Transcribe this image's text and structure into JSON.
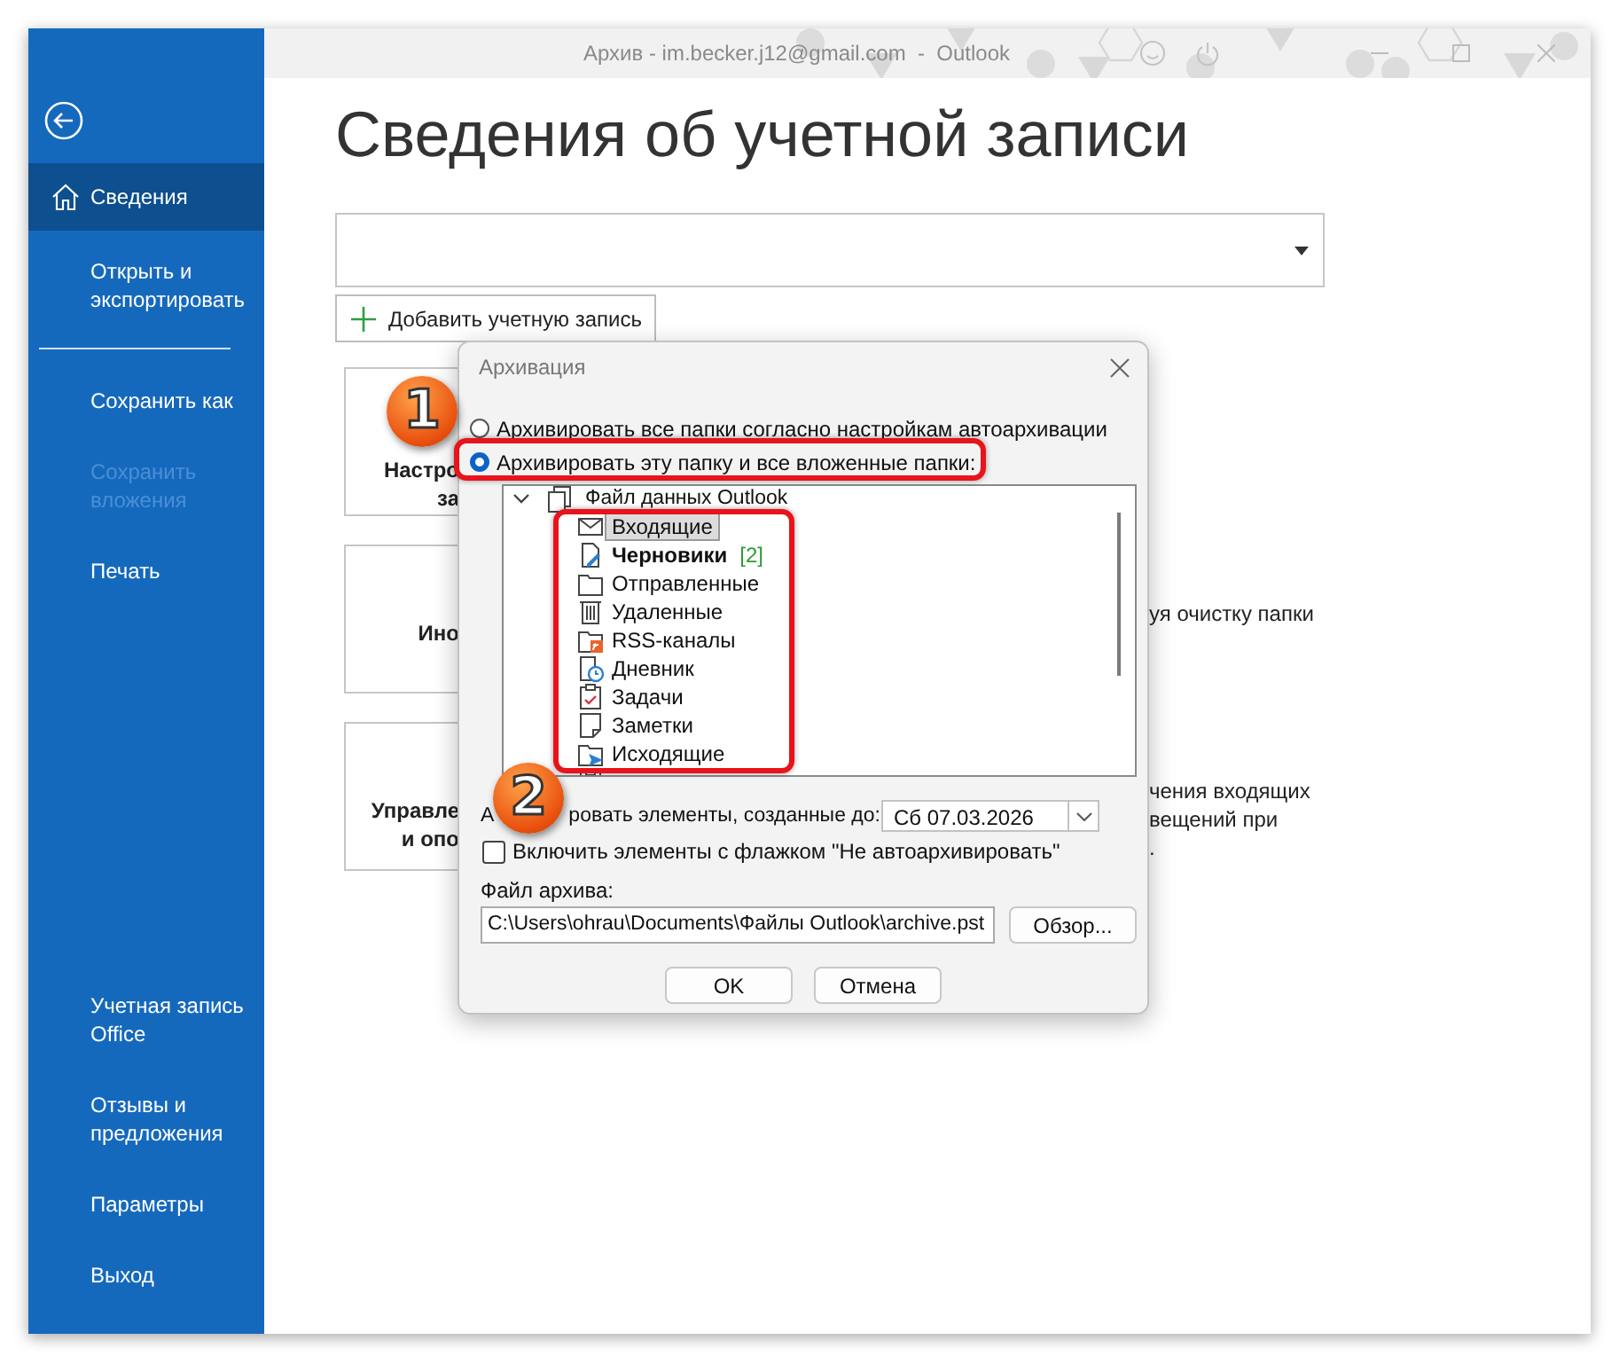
{
  "window": {
    "title": "Архив - im.becker.j12@gmail.com  -  Outlook"
  },
  "sidebar": {
    "top_items": [
      {
        "kind": "home",
        "label": "Сведения",
        "selected": true,
        "disabled": false
      },
      {
        "kind": "text",
        "label": "Открыть и\nэкспортировать",
        "selected": false,
        "disabled": false
      },
      {
        "kind": "divider"
      },
      {
        "kind": "text",
        "label": "Сохранить как",
        "selected": false,
        "disabled": false
      },
      {
        "kind": "text",
        "label": "Сохранить\nвложения",
        "selected": false,
        "disabled": true
      },
      {
        "kind": "text",
        "label": "Печать",
        "selected": false,
        "disabled": false
      }
    ],
    "bottom_items": [
      {
        "kind": "text",
        "label": "Учетная запись\nOffice",
        "selected": false,
        "disabled": false
      },
      {
        "kind": "text",
        "label": "Отзывы и\nпредложения",
        "selected": false,
        "disabled": false
      },
      {
        "kind": "text",
        "label": "Параметры",
        "selected": false,
        "disabled": false
      },
      {
        "kind": "text",
        "label": "Выход",
        "selected": false,
        "disabled": false
      }
    ]
  },
  "page": {
    "title": "Сведения об учетной записи",
    "add_account_button": "Добавить учетную запись",
    "cards": [
      {
        "lines": [
          "Настро",
          "за"
        ]
      },
      {
        "lines": [
          "Ино"
        ],
        "description": [
          "уя очистку папки"
        ]
      },
      {
        "lines": [
          "Управле",
          "и опо"
        ],
        "description": [
          "чения входящих",
          "вещений при",
          "."
        ]
      }
    ]
  },
  "dialog": {
    "title": "Архивация",
    "options": [
      {
        "label": "Архивировать все папки согласно настройкам автоархивации",
        "selected": false
      },
      {
        "label": "Архивировать эту папку и все вложенные папки:",
        "selected": true
      }
    ],
    "tree": {
      "label": "Файл данных Outlook",
      "expanded": true,
      "children": [
        {
          "kind": "inbox",
          "label": "Входящие",
          "selected": true,
          "unread": false
        },
        {
          "kind": "drafts",
          "label": "Черновики",
          "count": "[2]",
          "selected": false,
          "unread": true
        },
        {
          "kind": "folder",
          "label": "Отправленные",
          "selected": false,
          "unread": false
        },
        {
          "kind": "trash",
          "label": "Удаленные",
          "selected": false,
          "unread": false
        },
        {
          "kind": "rss",
          "label": "RSS-каналы",
          "selected": false,
          "unread": false
        },
        {
          "kind": "journal",
          "label": "Дневник",
          "selected": false,
          "unread": false
        },
        {
          "kind": "tasks",
          "label": "Задачи",
          "selected": false,
          "unread": false
        },
        {
          "kind": "notes",
          "label": "Заметки",
          "selected": false,
          "unread": false
        },
        {
          "kind": "outbox",
          "label": "Исходящие",
          "selected": false,
          "unread": false
        }
      ]
    },
    "date_label_parts": [
      "А",
      "ровать элементы, созданные до:"
    ],
    "date_value": "Сб 07.03.2026",
    "include_checkbox": {
      "label": "Включить элементы с флажком \"Не автоархивировать\"",
      "checked": false
    },
    "archive_file_label": "Файл архива:",
    "archive_file_path": "C:\\Users\\ohrau\\Documents\\Файлы Outlook\\archive.pst",
    "browse_button": "Обзор...",
    "buttons": [
      "OK",
      "Отмена"
    ]
  },
  "annotations": [
    {
      "label": "1"
    },
    {
      "label": "2"
    }
  ]
}
